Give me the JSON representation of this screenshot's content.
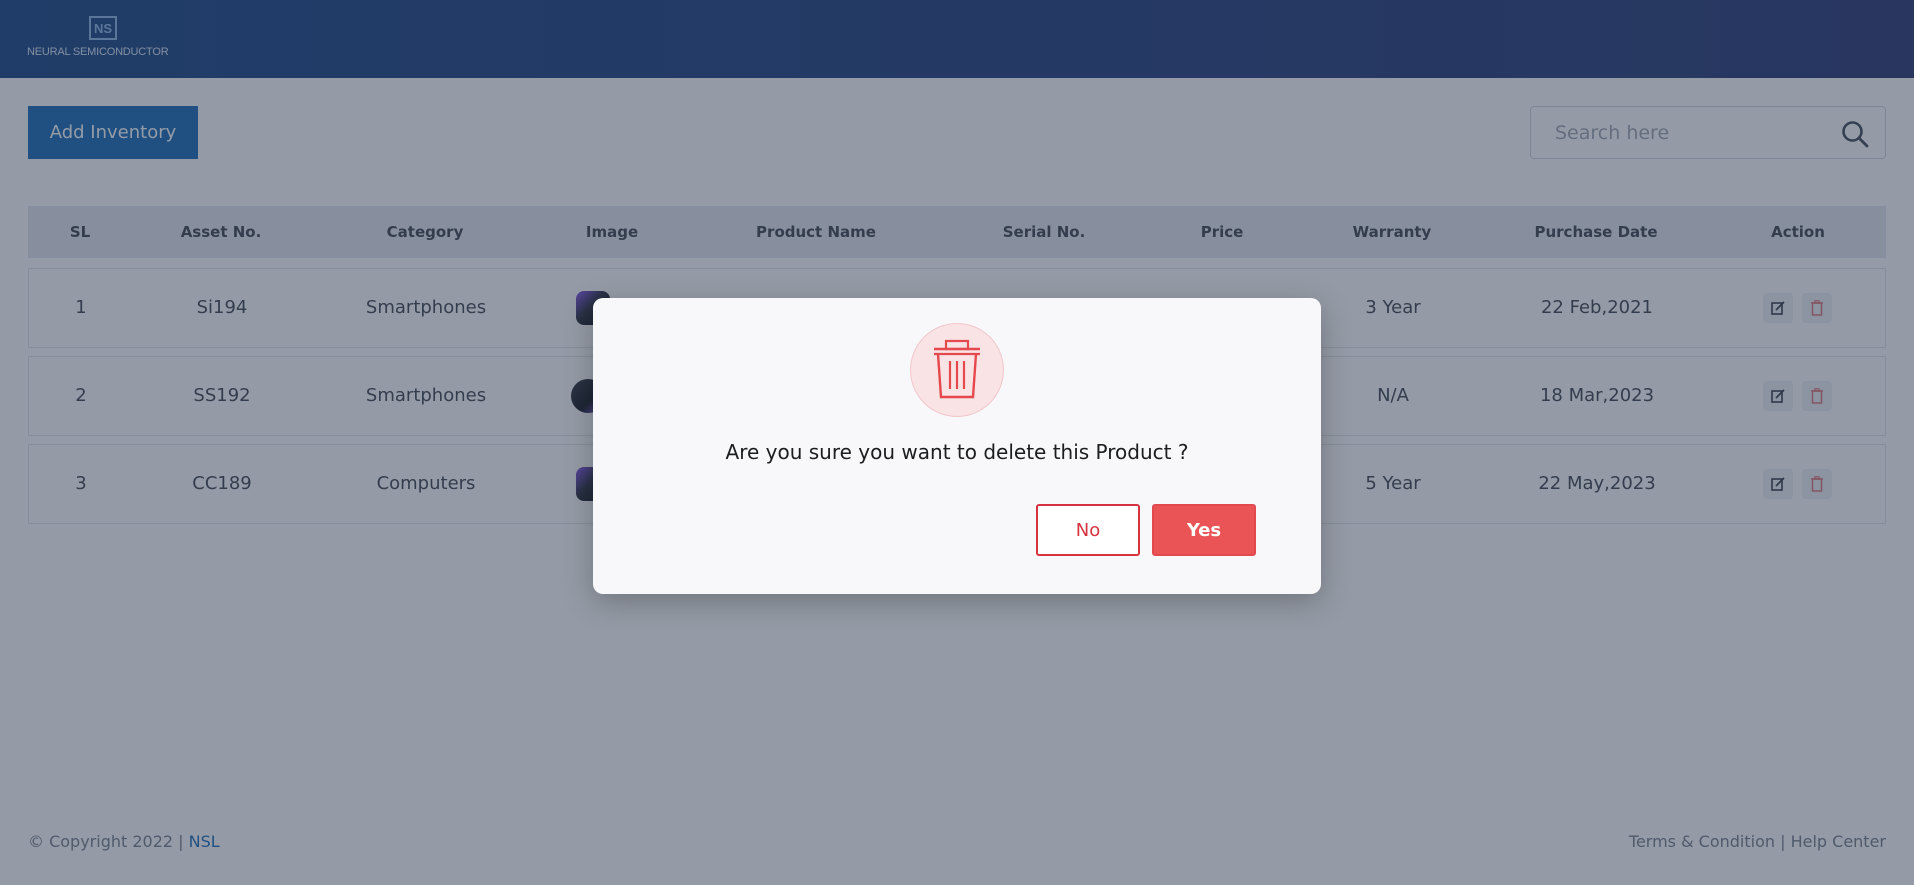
{
  "header": {
    "logo_text": "NEURAL SEMICONDUCTOR",
    "logo_mark": "NS"
  },
  "toolbar": {
    "add_label": "Add Inventory",
    "search_placeholder": "Search here",
    "search_value": ""
  },
  "table": {
    "columns": [
      "SL",
      "Asset No.",
      "Category",
      "Image",
      "Product Name",
      "Serial No.",
      "Price",
      "Warranty",
      "Purchase Date",
      "Action"
    ],
    "rows": [
      {
        "sl": "1",
        "asset": "Si194",
        "category": "Smartphones",
        "warranty": "3 Year",
        "date": "22 Feb,2021"
      },
      {
        "sl": "2",
        "asset": "SS192",
        "category": "Smartphones",
        "warranty": "N/A",
        "date": "18 Mar,2023"
      },
      {
        "sl": "3",
        "asset": "CC189",
        "category": "Computers",
        "warranty": "5 Year",
        "date": "22 May,2023"
      }
    ]
  },
  "footer": {
    "copyright": "© Copyright 2022 | ",
    "brand": "NSL",
    "terms": "Terms & Condition",
    "separator": " | ",
    "help": "Help Center"
  },
  "modal": {
    "message": "Are you sure you want to delete this Product ?",
    "no_label": "No",
    "yes_label": "Yes"
  },
  "colors": {
    "brand_blue": "#1d6fb8",
    "danger_red": "#ea5457",
    "overlay": "rgba(33,46,68,0.48)"
  },
  "icons": [
    "search-icon",
    "edit-icon",
    "trash-icon"
  ]
}
